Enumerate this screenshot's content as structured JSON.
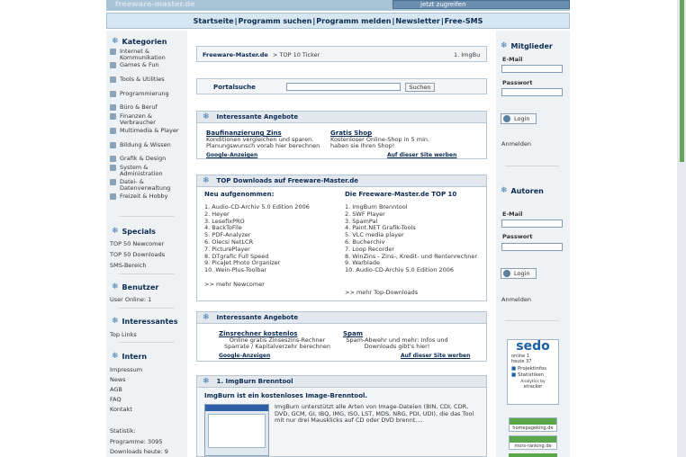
{
  "banner": {
    "logo": "freeware-master.de",
    "ad": "jetzt zugreifen"
  },
  "nav": [
    "Startseite",
    "Programm suchen",
    "Programm melden",
    "Newsletter",
    "Free-SMS"
  ],
  "left": {
    "kategorien": "Kategorien",
    "cats": [
      "Internet & Kommunikation",
      "Games & Fun",
      "Tools & Utilities",
      "Programmierung",
      "Büro & Beruf",
      "Finanzen & Verbraucher",
      "Multimedia & Player",
      "Bildung & Wissen",
      "Grafik & Design",
      "System & Administration",
      "Datei- & Datenverwaltung",
      "Freizeit & Hobby"
    ],
    "specials": "Specials",
    "specials_items": [
      "TOP 50 Newcomer",
      "TOP 50 Downloads",
      "SMS-Bereich"
    ],
    "benutzer": "Benutzer",
    "user_online": "User Online: 1",
    "interessantes": "Interessantes",
    "toplinks": "Top Links",
    "intern": "Intern",
    "intern_items": [
      "Impressum",
      "News",
      "AGB",
      "FAQ",
      "Kontakt"
    ],
    "statistik": "Statistik:",
    "programme": "Programme: 3095",
    "downloads": "Downloads heute: 9"
  },
  "main": {
    "breadcrumb_home": "Freeware-Master.de",
    "breadcrumb_rest": " > TOP 10 Ticker",
    "breadcrumb_right": "1. ImgBu",
    "portalsuche": "Portalsuche",
    "suchen": "Suchen",
    "angebote_title": "Interessante Angebote",
    "ang1_title": "Baufinanzierung Zins",
    "ang1_text": "Konditionen vergleichen und sparen. Planungswunsch vorab hier berechnen",
    "ang2_title": "Gratis Shop",
    "ang2_text": "Kostenloser Online-Shop in 5 min. haben sie Ihren Shop!",
    "google_ads": "Google-Anzeigen",
    "auf_dieser": "Auf dieser Site werben",
    "top_title": "TOP Downloads auf Freeware-Master.de",
    "neu_head": "Neu aufgenommen:",
    "neu": [
      "1. Audio-CD-Archiv 5.0 Edition 2006",
      "2. Heyer",
      "3. LesefixPRO",
      "4. BackToFile",
      "5. PDF-Analyzer",
      "6. Olecsi NetLCR",
      "7. PicturePlayer",
      "8. DTgrafic Full Speed",
      "9. PicaJet Photo Organizer",
      "10. Wein-Plus-Toolbar"
    ],
    "mehr_newcomer": ">> mehr Newcomer",
    "top10_head": "Die Freeware-Master.de TOP 10",
    "top10": [
      "1. ImgBurn Brenntool",
      "2. SWF Player",
      "3. SpamPal",
      "4. Paint.NET Grafik-Tools",
      "5. VLC media player",
      "6. Bucherchiv",
      "7. Loop Recorder",
      "8. WinZins - Zins-, Kredit- und Rentenrechner",
      "9. Warblade",
      "10. Audio-CD-Archiv 5.0 Edition 2006"
    ],
    "mehr_top": ">> mehr Top-Downloads",
    "ang3_title": "Zinsrechner kostenlos",
    "ang3_text": "Online gratis Zinseszins-Rechner Sparrate / Kapitalverzehr berechnen",
    "ang4_title": "Spam",
    "ang4_text": "Spam-Abwehr und mehr: Infos und Downloads gibt's hier!",
    "img_title": "1. ImgBurn Brenntool",
    "img_sub": "ImgBurn ist ein kostenloses Image-Brenntool.",
    "img_text": "ImgBurn unterstützt alle Arten von Image-Dateien (BIN, CDI, CDR, DVD, GCM, GI, IBQ, IMG, ISO, LST, MDS, NRG, PDI, UDI), die das Tool mit nur drei Mausklicks auf CD oder DVD brennt...."
  },
  "right": {
    "mitglieder": "Mitglieder",
    "email": "E-Mail",
    "passwort": "Passwort",
    "login": "Login",
    "anmelden": "Anmelden",
    "autoren": "Autoren",
    "sedo": "sedo",
    "sedo_online": "online 1",
    "sedo_heute": "heute 37",
    "sedo_proj": "Projektinfos",
    "sedo_stat": "Statistiken",
    "sedo_by": "Analytics by",
    "sedo_tracker": "etracker",
    "badge1": "homepageking.de",
    "badge2": "mors-ranking.de"
  }
}
